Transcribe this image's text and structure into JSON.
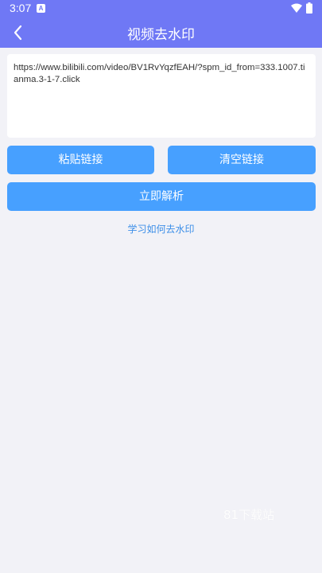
{
  "status_bar": {
    "time": "3:07",
    "notification_icon": "a-icon",
    "wifi_icon": "wifi-icon",
    "battery_icon": "battery-icon"
  },
  "header": {
    "title": "视频去水印",
    "back_icon": "chevron-left-icon",
    "background_color": "#6f78f5"
  },
  "url_input": {
    "value": "https://www.bilibili.com/video/BV1RvYqzfEAH/?spm_id_from=333.1007.tianma.3-1-7.click"
  },
  "buttons": {
    "paste_label": "粘贴链接",
    "clear_label": "清空链接",
    "parse_label": "立即解析",
    "color": "#47a0ff"
  },
  "help_link": "学习如何去水印",
  "watermark": "81下载站"
}
